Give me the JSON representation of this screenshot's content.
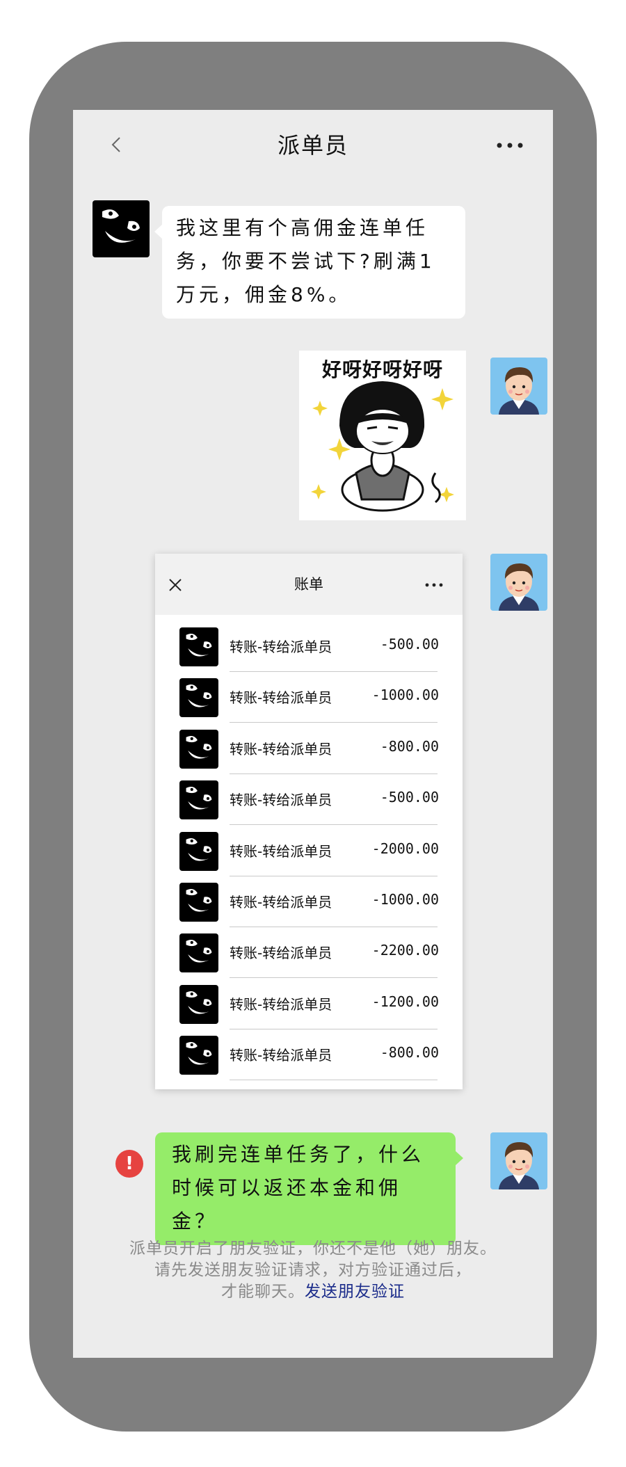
{
  "header": {
    "title": "派单员"
  },
  "messages": {
    "first": {
      "text": "我这里有个高佣金连单任务，你要不尝试下?刷满1万元，佣金8%。"
    },
    "sticker": {
      "caption": "好呀好呀好呀"
    },
    "last": {
      "text": "我刷完连单任务了，什么时候可以返还本金和佣金？",
      "error_mark": "!"
    }
  },
  "bill": {
    "title": "账单",
    "rows": [
      {
        "label": "转账-转给派单员",
        "amount": "-500.00"
      },
      {
        "label": "转账-转给派单员",
        "amount": "-1000.00"
      },
      {
        "label": "转账-转给派单员",
        "amount": "-800.00"
      },
      {
        "label": "转账-转给派单员",
        "amount": "-500.00"
      },
      {
        "label": "转账-转给派单员",
        "amount": "-2000.00"
      },
      {
        "label": "转账-转给派单员",
        "amount": "-1000.00"
      },
      {
        "label": "转账-转给派单员",
        "amount": "-2200.00"
      },
      {
        "label": "转账-转给派单员",
        "amount": "-1200.00"
      },
      {
        "label": "转账-转给派单员",
        "amount": "-800.00"
      }
    ]
  },
  "notice": {
    "line1": "派单员开启了朋友验证，你还不是他（她）朋友。",
    "line2": "请先发送朋友验证请求，对方验证通过后，",
    "line3_prefix": "才能聊天。",
    "link": "发送朋友验证"
  },
  "colors": {
    "frame": "#7f7f7f",
    "screen_bg": "#ececec",
    "sent_bubble": "#95ec69",
    "error": "#e64340",
    "link": "#1a2b8a"
  }
}
